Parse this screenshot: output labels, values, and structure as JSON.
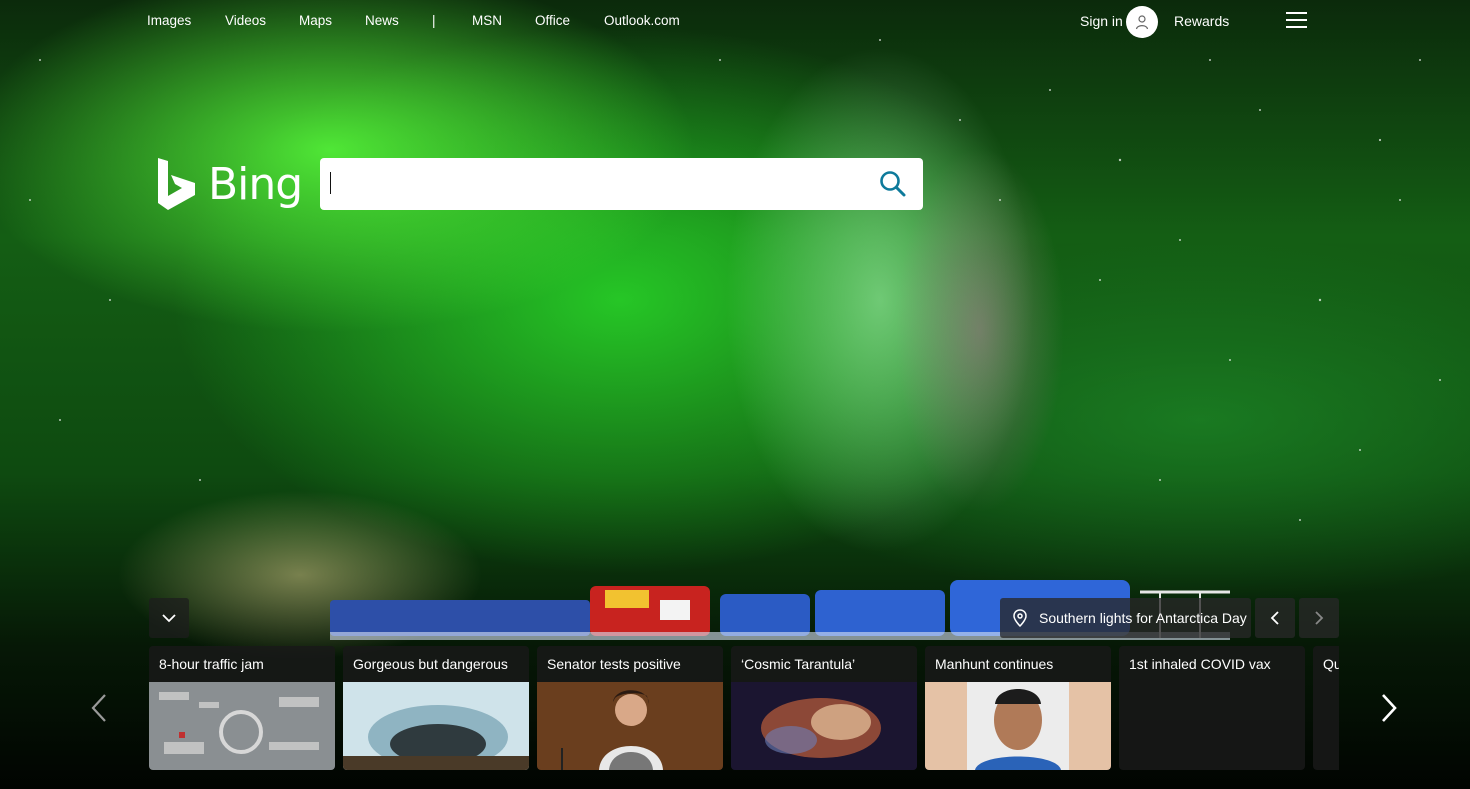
{
  "nav": {
    "links": [
      "Images",
      "Videos",
      "Maps",
      "News",
      "|",
      "MSN",
      "Office",
      "Outlook.com"
    ],
    "sign_in": "Sign in",
    "rewards": "Rewards"
  },
  "brand": {
    "name": "Bing"
  },
  "search": {
    "value": "",
    "placeholder": ""
  },
  "image_of_day": {
    "title": "Southern lights for Antarctica Day"
  },
  "news_cards": [
    {
      "title": "8-hour traffic jam"
    },
    {
      "title": "Gorgeous but dangerous"
    },
    {
      "title": "Senator tests positive"
    },
    {
      "title": "‘Cosmic Tarantula’"
    },
    {
      "title": "Manhunt continues"
    },
    {
      "title": "1st inhaled COVID vax"
    },
    {
      "title": "Qui"
    }
  ],
  "colors": {
    "search_icon": "#0e7a9b",
    "aurora_green": "#2fd42f"
  }
}
